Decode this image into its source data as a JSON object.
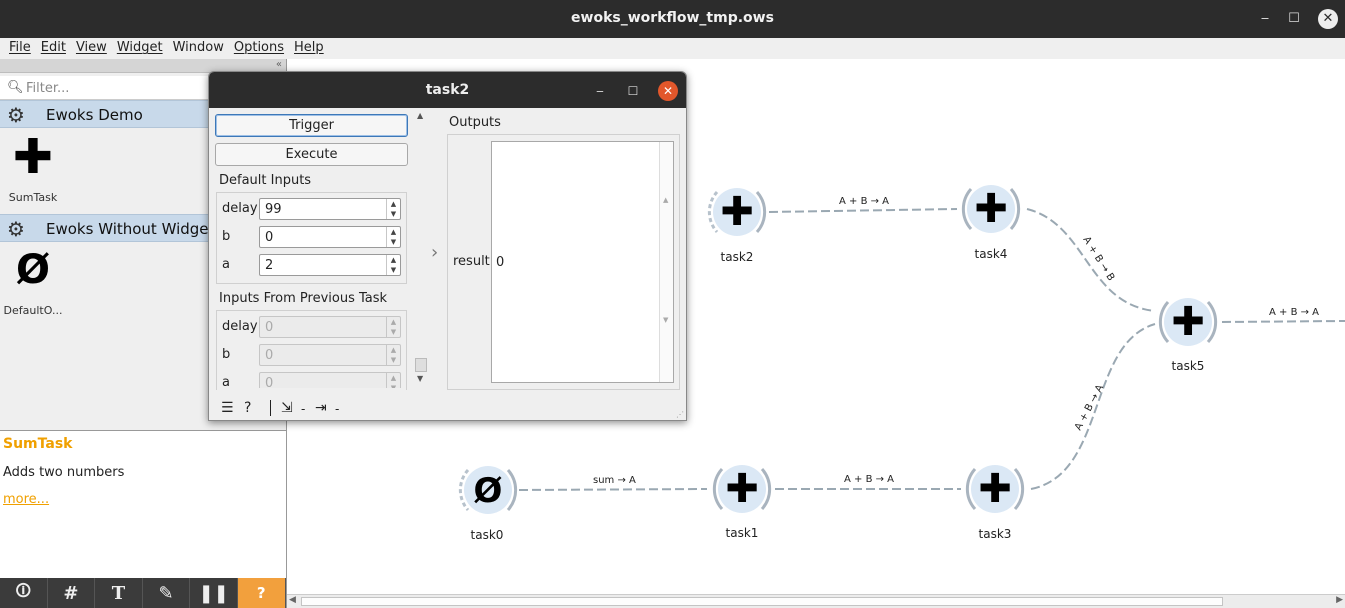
{
  "window": {
    "title": "ewoks_workflow_tmp.ows",
    "minimize": "‒",
    "maximize": "☐",
    "close": "✕"
  },
  "menu": [
    "File",
    "Edit",
    "View",
    "Widget",
    "Window",
    "Options",
    "Help"
  ],
  "sidebar": {
    "filter_placeholder": "Filter...",
    "categories": [
      {
        "label": "Ewoks Demo",
        "icon": "gear-icon",
        "widgets": [
          {
            "name": "SumTask",
            "icon": "plus-icon"
          }
        ]
      },
      {
        "label": "Ewoks Without Widgets",
        "icon": "gear-icon",
        "widgets": [
          {
            "name": "DefaultO...",
            "icon": "empty-set-icon"
          }
        ]
      }
    ],
    "description": {
      "title": "SumTask",
      "text": "Adds two numbers",
      "more": "more..."
    },
    "toolbar": [
      "info-icon",
      "grid-icon",
      "text-annotation-icon",
      "arrow-annotation-icon",
      "pause-icon",
      "help-icon"
    ]
  },
  "workflow": {
    "nodes": [
      {
        "id": "task0",
        "label": "task0",
        "icon": "empty-set-icon"
      },
      {
        "id": "task1",
        "label": "task1",
        "icon": "plus-icon"
      },
      {
        "id": "task2",
        "label": "task2",
        "icon": "plus-icon"
      },
      {
        "id": "task3",
        "label": "task3",
        "icon": "plus-icon"
      },
      {
        "id": "task4",
        "label": "task4",
        "icon": "plus-icon"
      },
      {
        "id": "task5",
        "label": "task5",
        "icon": "plus-icon"
      }
    ],
    "links": [
      {
        "from": "task0",
        "to": "task1",
        "label": "sum → A"
      },
      {
        "from": "task1",
        "to": "task3",
        "label": "A + B → A"
      },
      {
        "from": "task3",
        "to": "task5",
        "label": "A + B → A"
      },
      {
        "from": "task2",
        "to": "task4",
        "label": "A + B → A"
      },
      {
        "from": "task4",
        "to": "task5",
        "label": "A + B → B"
      },
      {
        "from": "task5",
        "to": "out",
        "label": "A + B → A"
      }
    ]
  },
  "task_window": {
    "title": "task2",
    "trigger_label": "Trigger",
    "execute_label": "Execute",
    "default_inputs_label": "Default Inputs",
    "default_inputs": [
      {
        "name": "delay",
        "value": "99"
      },
      {
        "name": "b",
        "value": "0"
      },
      {
        "name": "a",
        "value": "2"
      }
    ],
    "previous_inputs_label": "Inputs From Previous Task",
    "previous_inputs": [
      {
        "name": "delay",
        "value": "0"
      },
      {
        "name": "b",
        "value": "0"
      },
      {
        "name": "a",
        "value": "0"
      }
    ],
    "outputs_label": "Outputs",
    "outputs": [
      {
        "name": "result",
        "value": "0"
      }
    ],
    "footer": {
      "input_count": "-",
      "output_count": "-"
    }
  }
}
